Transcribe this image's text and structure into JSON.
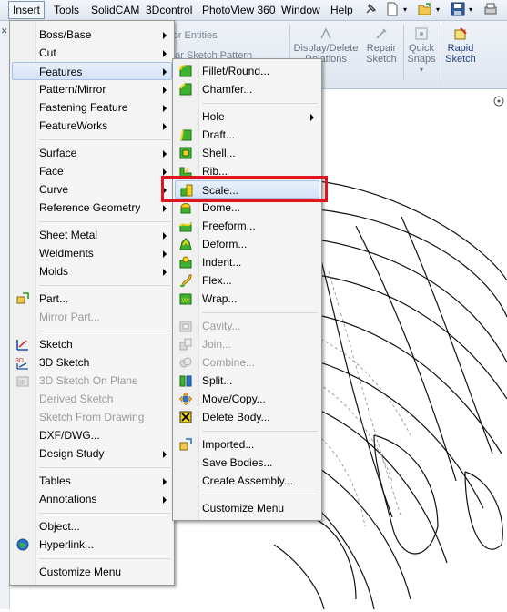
{
  "menubar": {
    "items": [
      "Insert",
      "Tools",
      "SolidCAM",
      "3Dcontrol",
      "PhotoView 360",
      "Window",
      "Help"
    ]
  },
  "ribbon": {
    "mirror_entities": "ror Entities",
    "sketch_pattern": "ear Sketch Pattern",
    "display_delete": "Display/Delete Relations",
    "repair_sketch": "Repair Sketch",
    "quick_snaps": "Quick Snaps",
    "rapid_sketch": "Rapid Sketch"
  },
  "insert_menu": {
    "items": [
      {
        "label": "Boss/Base",
        "submenu": true
      },
      {
        "label": "Cut",
        "submenu": true
      },
      {
        "label": "Features",
        "submenu": true,
        "selected": true
      },
      {
        "label": "Pattern/Mirror",
        "submenu": true
      },
      {
        "label": "Fastening Feature",
        "submenu": true
      },
      {
        "label": "FeatureWorks",
        "submenu": true
      },
      {
        "label": "Surface",
        "submenu": true
      },
      {
        "label": "Face",
        "submenu": true
      },
      {
        "label": "Curve",
        "submenu": true
      },
      {
        "label": "Reference Geometry",
        "submenu": true
      },
      {
        "label": "Sheet Metal",
        "submenu": true
      },
      {
        "label": "Weldments",
        "submenu": true
      },
      {
        "label": "Molds",
        "submenu": true
      },
      {
        "label": "Part..."
      },
      {
        "label": "Mirror Part...",
        "disabled": true
      },
      {
        "label": "Sketch"
      },
      {
        "label": "3D Sketch"
      },
      {
        "label": "3D Sketch On Plane",
        "disabled": true
      },
      {
        "label": "Derived Sketch",
        "disabled": true
      },
      {
        "label": "Sketch From Drawing",
        "disabled": true
      },
      {
        "label": "DXF/DWG..."
      },
      {
        "label": "Design Study",
        "submenu": true
      },
      {
        "label": "Tables",
        "submenu": true
      },
      {
        "label": "Annotations",
        "submenu": true
      },
      {
        "label": "Object..."
      },
      {
        "label": "Hyperlink..."
      },
      {
        "label": "Customize Menu"
      }
    ]
  },
  "features_menu": {
    "items": [
      {
        "label": "Fillet/Round..."
      },
      {
        "label": "Chamfer..."
      },
      {
        "label": "Hole",
        "submenu": true
      },
      {
        "label": "Draft..."
      },
      {
        "label": "Shell..."
      },
      {
        "label": "Rib..."
      },
      {
        "label": "Scale..."
      },
      {
        "label": "Dome..."
      },
      {
        "label": "Freeform..."
      },
      {
        "label": "Deform..."
      },
      {
        "label": "Indent..."
      },
      {
        "label": "Flex..."
      },
      {
        "label": "Wrap..."
      },
      {
        "label": "Cavity...",
        "disabled": true
      },
      {
        "label": "Join...",
        "disabled": true
      },
      {
        "label": "Combine...",
        "disabled": true
      },
      {
        "label": "Split..."
      },
      {
        "label": "Move/Copy..."
      },
      {
        "label": "Delete Body..."
      },
      {
        "label": "Imported..."
      },
      {
        "label": "Save Bodies..."
      },
      {
        "label": "Create Assembly..."
      },
      {
        "label": "Customize Menu"
      }
    ]
  },
  "colors": {
    "highlight": "#e0151e",
    "selection": "#d5e3f7",
    "feature_icon_green": "#3cb22e",
    "feature_icon_yellow": "#f2d21a"
  }
}
